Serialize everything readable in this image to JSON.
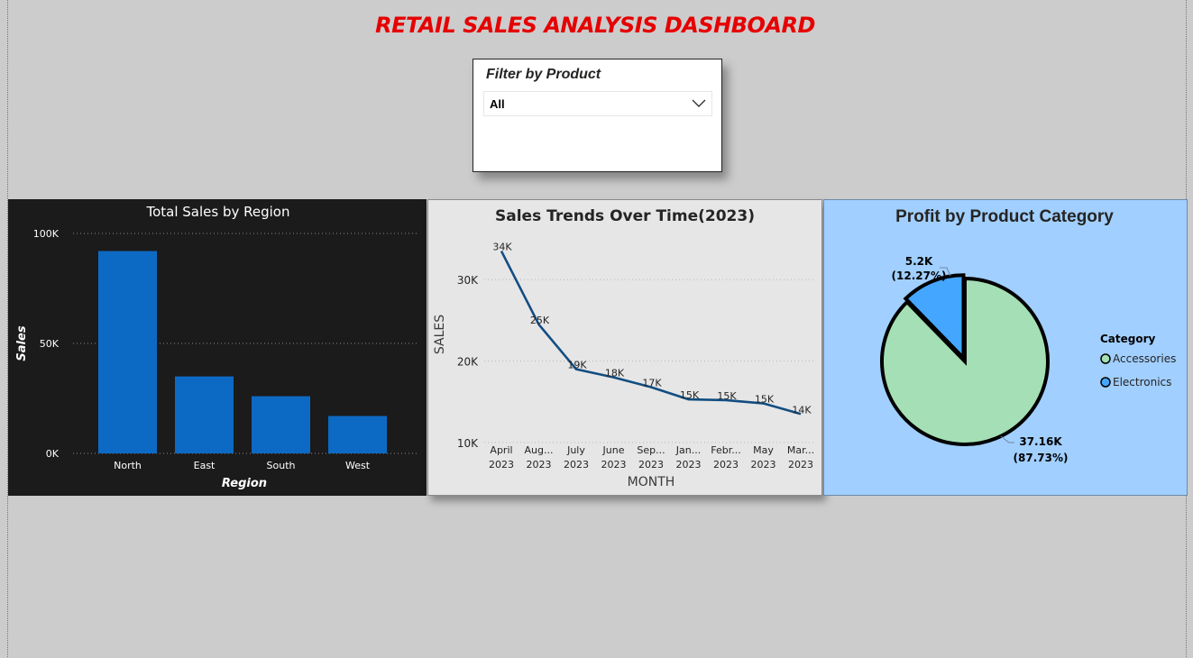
{
  "dashboard": {
    "title": "RETAIL SALES ANALYSIS DASHBOARD"
  },
  "filter": {
    "title": "Filter by Product",
    "selected": "All",
    "icon": "chevron-down-icon"
  },
  "colors": {
    "title_red": "#e60000",
    "bar_blue": "#0d6ac4",
    "line_blue": "#124d82",
    "pie_accessories": "#a5dfb5",
    "pie_electronics": "#44a6ff",
    "panel_dark": "#1b1b1b",
    "panel_light": "#e6e6e6",
    "panel_blue": "#a1cfff"
  },
  "chart_data": [
    {
      "type": "bar",
      "title": "Total Sales by Region",
      "xlabel": "Region",
      "ylabel": "Sales",
      "categories": [
        "North",
        "East",
        "South",
        "West"
      ],
      "values": [
        92000,
        35000,
        26000,
        17000
      ],
      "ylim": [
        0,
        100000
      ],
      "yticks": [
        {
          "value": 0,
          "label": "0K"
        },
        {
          "value": 50000,
          "label": "50K"
        },
        {
          "value": 100000,
          "label": "100K"
        }
      ],
      "grid": true
    },
    {
      "type": "line",
      "title": "Sales Trends Over Time(2023)",
      "xlabel": "MONTH",
      "ylabel": "SALES",
      "x": [
        {
          "month": "April",
          "year": "2023"
        },
        {
          "month": "Aug...",
          "year": "2023"
        },
        {
          "month": "July",
          "year": "2023"
        },
        {
          "month": "June",
          "year": "2023"
        },
        {
          "month": "Sep...",
          "year": "2023"
        },
        {
          "month": "Jan...",
          "year": "2023"
        },
        {
          "month": "Febr...",
          "year": "2023"
        },
        {
          "month": "May",
          "year": "2023"
        },
        {
          "month": "Mar...",
          "year": "2023"
        }
      ],
      "values": [
        33500,
        24500,
        19000,
        18000,
        16800,
        15300,
        15200,
        14800,
        13500
      ],
      "data_labels": [
        "34K",
        "25K",
        "19K",
        "18K",
        "17K",
        "15K",
        "15K",
        "15K",
        "14K"
      ],
      "ylim": [
        8000,
        36000
      ],
      "yticks": [
        {
          "value": 10000,
          "label": "10K"
        },
        {
          "value": 20000,
          "label": "20K"
        },
        {
          "value": 30000,
          "label": "30K"
        }
      ],
      "grid": true
    },
    {
      "type": "pie",
      "title": "Profit by Product Category",
      "legend_title": "Category",
      "legend_position": "right",
      "slices": [
        {
          "label": "Accessories",
          "value": 37160,
          "value_label": "37.16K",
          "pct_label": "(87.73%)"
        },
        {
          "label": "Electronics",
          "value": 5200,
          "value_label": "5.2K",
          "pct_label": "(12.27%)"
        }
      ]
    }
  ]
}
